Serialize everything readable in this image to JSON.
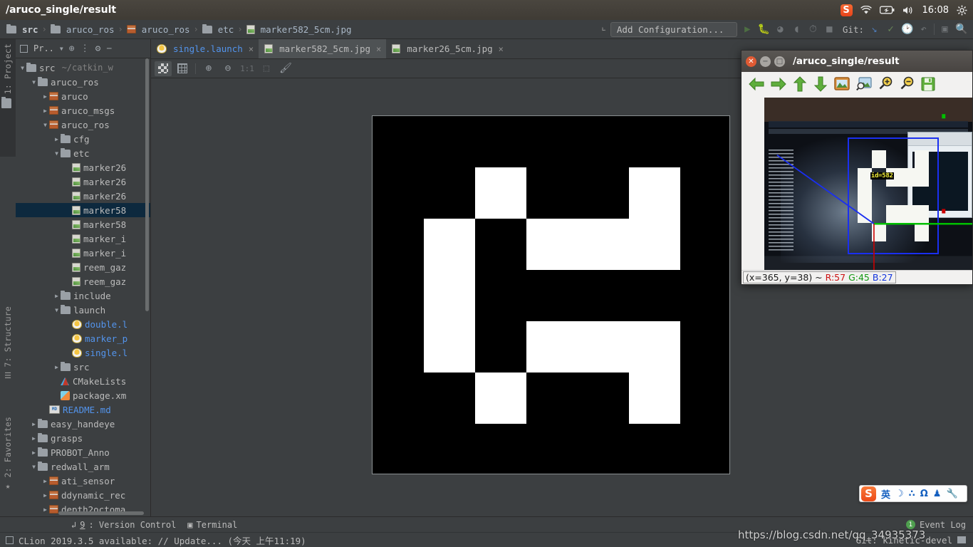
{
  "os_panel": {
    "title": "/aruco_single/result",
    "clock": "16:08",
    "tray": [
      "sogou-badge",
      "wifi-icon",
      "battery-icon",
      "volume-icon",
      "settings-gear-icon"
    ]
  },
  "navbar": {
    "breadcrumbs": [
      {
        "label": "src",
        "icon": "folder-icon"
      },
      {
        "label": "aruco_ros",
        "icon": "folder-icon"
      },
      {
        "label": "aruco_ros",
        "icon": "package-icon"
      },
      {
        "label": "etc",
        "icon": "folder-icon"
      },
      {
        "label": "marker582_5cm.jpg",
        "icon": "image-file-icon"
      }
    ],
    "separator": "›",
    "run_configuration": "Add Configuration...",
    "git_label": "Git:",
    "toolbar_icons": [
      "run-icon",
      "debug-icon",
      "coverage-icon",
      "profile-icon",
      "rerun-icon",
      "stop-icon",
      "update-project-icon",
      "commit-icon",
      "history-icon",
      "rollback-icon",
      "terminal-icon",
      "search-everywhere-icon"
    ]
  },
  "left_strips": {
    "project": "1: Project",
    "structure": "7: Structure",
    "favorites": "2: Favorites"
  },
  "project_panel": {
    "header_title": "Pr..",
    "header_icons": [
      "project-view-selector-icon",
      "locate-icon",
      "collapse-all-icon",
      "settings-gear-icon",
      "hide-icon"
    ],
    "tree": [
      {
        "depth": 0,
        "arrow": "down",
        "icon": "folder-icon",
        "label": "src",
        "path": "~/catkin_w",
        "wavy": true
      },
      {
        "depth": 1,
        "arrow": "down",
        "icon": "folder-icon",
        "label": "aruco_ros"
      },
      {
        "depth": 2,
        "arrow": "right",
        "icon": "package-icon",
        "label": "aruco"
      },
      {
        "depth": 2,
        "arrow": "right",
        "icon": "package-icon",
        "label": "aruco_msgs"
      },
      {
        "depth": 2,
        "arrow": "down",
        "icon": "package-icon",
        "label": "aruco_ros"
      },
      {
        "depth": 3,
        "arrow": "right",
        "icon": "folder-icon",
        "label": "cfg"
      },
      {
        "depth": 3,
        "arrow": "down",
        "icon": "folder-icon",
        "label": "etc"
      },
      {
        "depth": 4,
        "arrow": "none",
        "icon": "image-file-icon",
        "label": "marker26"
      },
      {
        "depth": 4,
        "arrow": "none",
        "icon": "image-file-icon",
        "label": "marker26"
      },
      {
        "depth": 4,
        "arrow": "none",
        "icon": "image-file-icon",
        "label": "marker26"
      },
      {
        "depth": 4,
        "arrow": "none",
        "icon": "image-file-icon",
        "label": "marker58",
        "selected": true
      },
      {
        "depth": 4,
        "arrow": "none",
        "icon": "image-file-icon",
        "label": "marker58"
      },
      {
        "depth": 4,
        "arrow": "none",
        "icon": "image-file-icon",
        "label": "marker_i"
      },
      {
        "depth": 4,
        "arrow": "none",
        "icon": "image-file-icon",
        "label": "marker_i"
      },
      {
        "depth": 4,
        "arrow": "none",
        "icon": "image-file-icon",
        "label": "reem_gaz"
      },
      {
        "depth": 4,
        "arrow": "none",
        "icon": "image-file-icon",
        "label": "reem_gaz"
      },
      {
        "depth": 3,
        "arrow": "right",
        "icon": "folder-icon",
        "label": "include"
      },
      {
        "depth": 3,
        "arrow": "down",
        "icon": "folder-icon",
        "label": "launch"
      },
      {
        "depth": 4,
        "arrow": "none",
        "icon": "launch-file-icon",
        "label": "double.l",
        "blue": true
      },
      {
        "depth": 4,
        "arrow": "none",
        "icon": "launch-file-icon",
        "label": "marker_p",
        "blue": true
      },
      {
        "depth": 4,
        "arrow": "none",
        "icon": "launch-file-icon",
        "label": "single.l",
        "blue": true
      },
      {
        "depth": 3,
        "arrow": "right",
        "icon": "folder-icon",
        "label": "src"
      },
      {
        "depth": 3,
        "arrow": "none",
        "icon": "cmake-icon",
        "label": "CMakeLists"
      },
      {
        "depth": 3,
        "arrow": "none",
        "icon": "xml-file-icon",
        "label": "package.xm"
      },
      {
        "depth": 2,
        "arrow": "none",
        "icon": "markdown-icon",
        "label": "README.md",
        "blue": true
      },
      {
        "depth": 1,
        "arrow": "right",
        "icon": "folder-icon",
        "label": "easy_handeye"
      },
      {
        "depth": 1,
        "arrow": "right",
        "icon": "folder-icon",
        "label": "grasps"
      },
      {
        "depth": 1,
        "arrow": "right",
        "icon": "folder-icon",
        "label": "PROBOT_Anno",
        "wavy": true
      },
      {
        "depth": 1,
        "arrow": "down",
        "icon": "folder-icon",
        "label": "redwall_arm"
      },
      {
        "depth": 2,
        "arrow": "right",
        "icon": "package-icon",
        "label": "ati_sensor"
      },
      {
        "depth": 2,
        "arrow": "right",
        "icon": "package-icon",
        "label": "ddynamic_rec"
      },
      {
        "depth": 2,
        "arrow": "right",
        "icon": "package-icon",
        "label": "depth2octoma"
      }
    ]
  },
  "editor_tabs": [
    {
      "label": "single.launch",
      "icon": "launch-file-icon",
      "active": false,
      "blue": true
    },
    {
      "label": "marker582_5cm.jpg",
      "icon": "image-file-icon",
      "active": true
    },
    {
      "label": "marker26_5cm.jpg",
      "icon": "image-file-icon",
      "active": false
    }
  ],
  "image_toolbar": {
    "buttons": [
      {
        "name": "toggle-transparency-chessboard",
        "glyph": "checker",
        "active": true
      },
      {
        "name": "toggle-grid",
        "glyph": "grid",
        "active": false
      },
      {
        "name": "zoom-in",
        "glyph": "⊕",
        "active": false
      },
      {
        "name": "zoom-out",
        "glyph": "⊖",
        "active": false
      },
      {
        "name": "actual-size",
        "glyph": "1:1",
        "active": false,
        "dim": true
      },
      {
        "name": "fit-to-window",
        "glyph": "⬚",
        "active": false,
        "dim": true
      },
      {
        "name": "color-picker",
        "glyph": "✎",
        "active": false
      }
    ]
  },
  "marker_image": {
    "name": "marker582_5cm.jpg",
    "grid_rows": [
      [
        "b",
        "w",
        "b",
        "b",
        "w"
      ],
      [
        "w",
        "b",
        "w",
        "w",
        "w"
      ],
      [
        "w",
        "b",
        "b",
        "b",
        "b"
      ],
      [
        "w",
        "b",
        "w",
        "w",
        "w"
      ],
      [
        "b",
        "w",
        "b",
        "b",
        "w"
      ]
    ],
    "border_color": "#000000",
    "cell_white": "#ffffff"
  },
  "ros_image_view": {
    "title": "/aruco_single/result",
    "window_buttons": [
      "close-icon",
      "minimize-icon",
      "maximize-icon"
    ],
    "toolbar_icons": [
      "arrow-left-icon",
      "arrow-right-icon",
      "arrow-up-icon",
      "arrow-down-icon",
      "image-icon",
      "image-search-icon",
      "zoom-in-icon",
      "zoom-out-icon",
      "save-icon"
    ],
    "detection": {
      "id_label": "id=582",
      "marker_grid": [
        [
          "b",
          "w",
          "b",
          "b",
          "w"
        ],
        [
          "w",
          "b",
          "w",
          "w",
          "w"
        ],
        [
          "w",
          "b",
          "b",
          "b",
          "b"
        ],
        [
          "w",
          "b",
          "w",
          "w",
          "w"
        ],
        [
          "b",
          "w",
          "b",
          "b",
          "w"
        ]
      ],
      "bbox_color": "#1a2ff0",
      "axis_x_color": "#00c000",
      "axis_y_color": "#cc0000",
      "axis_z_color": "#0000ff"
    },
    "status": {
      "coords": "(x=365, y=38) ~",
      "r": "R:57",
      "g": "G:45",
      "b": "B:27"
    }
  },
  "ime_bar": {
    "logo": "S",
    "items": [
      "英",
      "☽",
      "∴",
      "Ω",
      "♟",
      "🔧"
    ]
  },
  "bottom_tools": [
    {
      "key": "9",
      "label": ": Version Control",
      "icon": "vcs-icon"
    },
    {
      "key": "",
      "label": "Terminal",
      "icon": "terminal-icon"
    }
  ],
  "event_log": {
    "count": "1",
    "label": "Event Log"
  },
  "status_bar": {
    "message": "CLion 2019.3.5 available: // Update... (今天 上午11:19)",
    "git_branch": "Git: kinetic-devel"
  },
  "watermark": "https://blog.csdn.net/qq_34935373"
}
